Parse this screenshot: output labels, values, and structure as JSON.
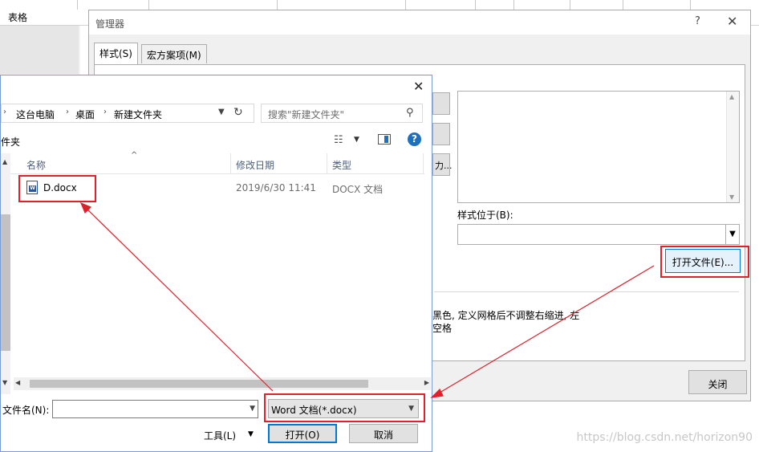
{
  "background": {
    "table_label": "表格"
  },
  "manager": {
    "title": "管理器",
    "help": "?",
    "close": "✕",
    "tabs": [
      {
        "label": "样式(S)"
      },
      {
        "label": "宏方案项(M)"
      }
    ],
    "style_location_label": "样式位于(B):",
    "open_file_button": "打开文件(E)...",
    "side_button_label": "力...",
    "description_line1": "黑色, 定义网格后不调整右缩进, 左",
    "description_line2": "空格",
    "close_button": "关闭"
  },
  "open_dialog": {
    "close": "✕",
    "breadcrumb": [
      "这台电脑",
      "桌面",
      "新建文件夹"
    ],
    "search_placeholder": "搜索\"新建文件夹\"",
    "folder_label": "件夹",
    "columns": [
      "名称",
      "修改日期",
      "类型"
    ],
    "files": [
      {
        "name": "D.docx",
        "modified": "2019/6/30 11:41",
        "type": "DOCX 文档"
      }
    ],
    "filename_label": "文件名(N):",
    "filename_value": "",
    "filetype_value": "Word 文档(*.docx)",
    "tools_button": "工具(L)",
    "open_button": "打开(O)",
    "cancel_button": "取消"
  },
  "watermark": "https://blog.csdn.net/horizon90",
  "colors": {
    "highlight": "#e0202a",
    "accent": "#0078d7"
  }
}
